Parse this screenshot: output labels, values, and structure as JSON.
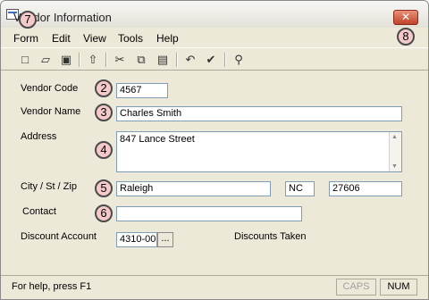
{
  "window": {
    "title": "Vendor Information",
    "close_label": "✕"
  },
  "menu": {
    "items": [
      "Form",
      "Edit",
      "View",
      "Tools",
      "Help"
    ]
  },
  "toolbar": {
    "icons": [
      "new-icon",
      "open-icon",
      "save-icon",
      "up-folder-icon",
      "cut-icon",
      "copy-icon",
      "paste-icon",
      "undo-icon",
      "spellcheck-icon",
      "find-icon"
    ]
  },
  "form": {
    "vendor_code_label": "Vendor Code",
    "vendor_code_value": "4567",
    "vendor_name_label": "Vendor Name",
    "vendor_name_value": "Charles Smith",
    "address_label": "Address",
    "address_value": "847 Lance Street",
    "city_label": "City / St / Zip",
    "city_value": "Raleigh",
    "state_value": "NC",
    "zip_value": "27606",
    "contact_label": "Contact",
    "contact_value": "",
    "discount_account_label": "Discount Account",
    "discount_account_value": "4310-00",
    "discount_button_label": "...",
    "discounts_taken_label": "Discounts Taken"
  },
  "markers": [
    "2",
    "3",
    "4",
    "5",
    "6",
    "7",
    "8"
  ],
  "status": {
    "help_text": "For help, press F1",
    "caps": "CAPS",
    "num": "NUM"
  }
}
